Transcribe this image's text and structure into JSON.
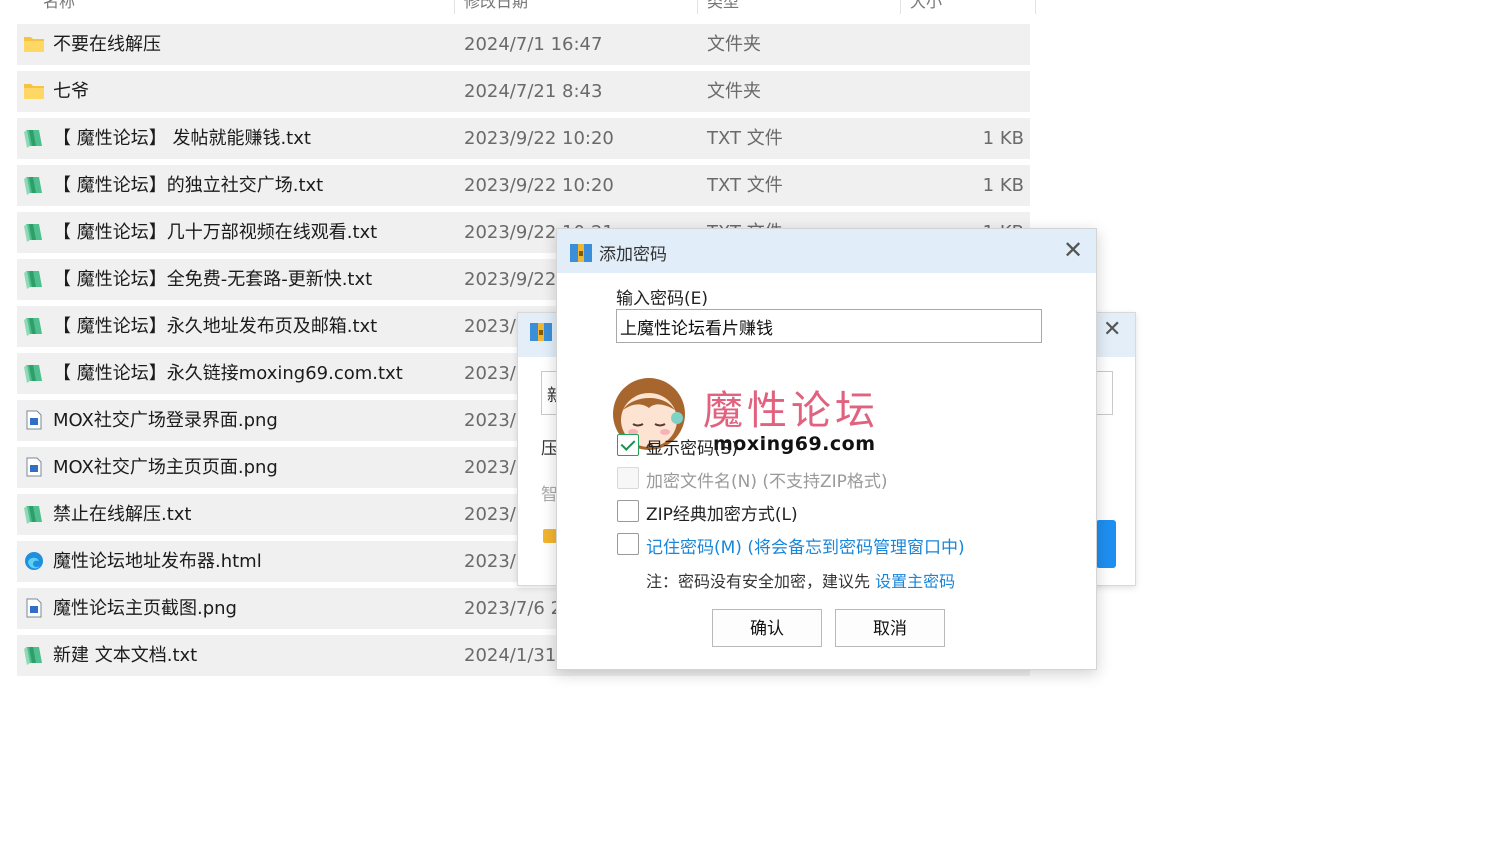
{
  "columns": [
    "名称",
    "修改日期",
    "类型",
    "大小"
  ],
  "files": [
    {
      "name": "不要在线解压",
      "date": "2024/7/1 16:47",
      "type": "文件夹",
      "size": "",
      "icon": "folder-icon"
    },
    {
      "name": "七爷",
      "date": "2024/7/21 8:43",
      "type": "文件夹",
      "size": "",
      "icon": "folder-icon"
    },
    {
      "name": "【 魔性论坛】 发帖就能赚钱.txt",
      "date": "2023/9/22 10:20",
      "type": "TXT 文件",
      "size": "1 KB",
      "icon": "text-file-icon"
    },
    {
      "name": "【 魔性论坛】的独立社交广场.txt",
      "date": "2023/9/22 10:20",
      "type": "TXT 文件",
      "size": "1 KB",
      "icon": "text-file-icon"
    },
    {
      "name": "【 魔性论坛】几十万部视频在线观看.txt",
      "date": "2023/9/22 10:21",
      "type": "TXT 文件",
      "size": "1 KB",
      "icon": "text-file-icon"
    },
    {
      "name": "【 魔性论坛】全免费-无套路-更新快.txt",
      "date": "2023/9/22",
      "type": "",
      "size": "",
      "icon": "text-file-icon"
    },
    {
      "name": "【 魔性论坛】永久地址发布页及邮箱.txt",
      "date": "2023/",
      "type": "",
      "size": "",
      "icon": "text-file-icon"
    },
    {
      "name": "【 魔性论坛】永久链接moxing69.com.txt",
      "date": "2023/",
      "type": "",
      "size": "",
      "icon": "text-file-icon"
    },
    {
      "name": "MOX社交广场登录界面.png",
      "date": "2023/",
      "type": "",
      "size": "",
      "icon": "image-file-icon"
    },
    {
      "name": "MOX社交广场主页页面.png",
      "date": "2023/",
      "type": "",
      "size": "",
      "icon": "image-file-icon"
    },
    {
      "name": "禁止在线解压.txt",
      "date": "2023/",
      "type": "",
      "size": "",
      "icon": "text-file-icon"
    },
    {
      "name": "魔性论坛地址发布器.html",
      "date": "2023/",
      "type": "",
      "size": "",
      "icon": "edge-html-icon"
    },
    {
      "name": "魔性论坛主页截图.png",
      "date": "2023/7/6 2",
      "type": "",
      "size": "",
      "icon": "image-file-icon"
    },
    {
      "name": "新建 文本文档.txt",
      "date": "2024/1/31",
      "type": "",
      "size": "",
      "icon": "text-file-icon"
    }
  ],
  "background_dialog": {
    "fragments": [
      "新",
      "压",
      "智"
    ]
  },
  "dialog": {
    "title": "添加密码",
    "password_label": "输入密码(E)",
    "password_value": "上魔性论坛看片赚钱",
    "checkboxes": [
      {
        "label": "显示密码(S)",
        "checked": true,
        "disabled": false,
        "style": "normal"
      },
      {
        "label": "加密文件名(N) (不支持ZIP格式)",
        "checked": false,
        "disabled": true,
        "style": "gray"
      },
      {
        "label": "ZIP经典加密方式(L)",
        "checked": false,
        "disabled": false,
        "style": "normal"
      },
      {
        "label": "记住密码(M) (将会备忘到密码管理窗口中)",
        "checked": false,
        "disabled": false,
        "style": "link"
      }
    ],
    "note_prefix": "注：密码没有安全加密，建议先 ",
    "note_link": "设置主密码",
    "ok_label": "确认",
    "cancel_label": "取消"
  },
  "watermark": {
    "brand": "魔性论坛",
    "domain": "moxing69.com"
  },
  "colors": {
    "row_bg": "#f0f0f0",
    "titlebar_bg": "#e1edf9",
    "link": "#1a86d9",
    "brand_pink": "#e0627f"
  }
}
